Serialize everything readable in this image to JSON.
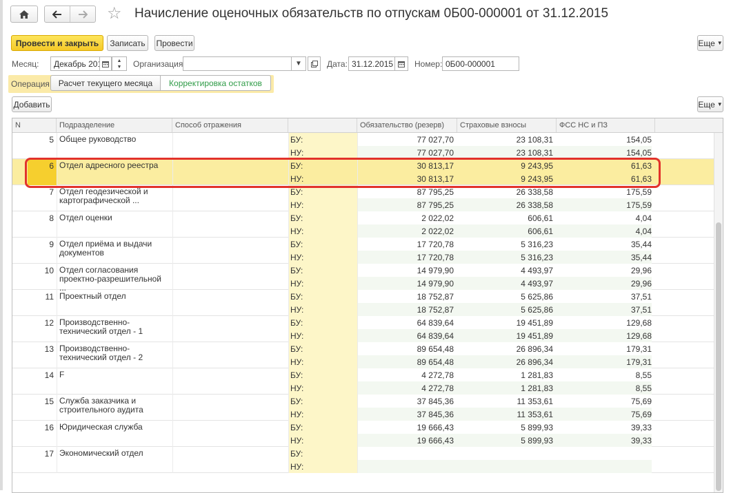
{
  "title": "Начисление оценочных обязательств по отпускам 0Б00-000001 от 31.12.2015",
  "toolbar": {
    "post_close": "Провести и закрыть",
    "save": "Записать",
    "post": "Провести",
    "more": "Еще"
  },
  "form": {
    "month_label": "Месяц:",
    "month_value": "Декабрь 201",
    "org_label": "Организация:",
    "org_value": "",
    "date_label": "Дата:",
    "date_value": "31.12.2015",
    "number_label": "Номер:",
    "number_value": "0Б00-000001"
  },
  "operation": {
    "label": "Операция:",
    "options": [
      "Расчет текущего месяца",
      "Корректировка остатков"
    ],
    "selected": "Расчет текущего месяца"
  },
  "table_toolbar": {
    "add": "Добавить",
    "more": "Еще"
  },
  "table": {
    "headers": [
      "N",
      "Подразделение",
      "Способ отражения",
      "",
      "Обязательство (резерв)",
      "Страховые взносы",
      "ФСС НС и ПЗ"
    ],
    "rows": [
      {
        "n": "5",
        "name": "Общее руководство",
        "bu_label": "БУ:",
        "nu_label": "НУ:",
        "bu": [
          "77 027,70",
          "23 108,31",
          "154,05"
        ],
        "nu": [
          "77 027,70",
          "23 108,31",
          "154,05"
        ]
      },
      {
        "n": "6",
        "name": "Отдел адресного реестра",
        "bu_label": "БУ:",
        "nu_label": "НУ:",
        "bu": [
          "30 813,17",
          "9 243,95",
          "61,63"
        ],
        "nu": [
          "30 813,17",
          "9 243,95",
          "61,63"
        ]
      },
      {
        "n": "7",
        "name": "Отдел геодезической и картографической ...",
        "bu_label": "БУ:",
        "nu_label": "НУ:",
        "bu": [
          "87 795,25",
          "26 338,58",
          "175,59"
        ],
        "nu": [
          "87 795,25",
          "26 338,58",
          "175,59"
        ]
      },
      {
        "n": "8",
        "name": "Отдел оценки",
        "bu_label": "БУ:",
        "nu_label": "НУ:",
        "bu": [
          "2 022,02",
          "606,61",
          "4,04"
        ],
        "nu": [
          "2 022,02",
          "606,61",
          "4,04"
        ]
      },
      {
        "n": "9",
        "name": "Отдел приёма и выдачи документов",
        "bu_label": "БУ:",
        "nu_label": "НУ:",
        "bu": [
          "17 720,78",
          "5 316,23",
          "35,44"
        ],
        "nu": [
          "17 720,78",
          "5 316,23",
          "35,44"
        ]
      },
      {
        "n": "10",
        "name": "Отдел согласования проектно-разрешительной ...",
        "bu_label": "БУ:",
        "nu_label": "НУ:",
        "bu": [
          "14 979,90",
          "4 493,97",
          "29,96"
        ],
        "nu": [
          "14 979,90",
          "4 493,97",
          "29,96"
        ]
      },
      {
        "n": "11",
        "name": "Проектный отдел",
        "bu_label": "БУ:",
        "nu_label": "НУ:",
        "bu": [
          "18 752,87",
          "5 625,86",
          "37,51"
        ],
        "nu": [
          "18 752,87",
          "5 625,86",
          "37,51"
        ]
      },
      {
        "n": "12",
        "name": "Производственно-технический отдел - 1",
        "bu_label": "БУ:",
        "nu_label": "НУ:",
        "bu": [
          "64 839,64",
          "19 451,89",
          "129,68"
        ],
        "nu": [
          "64 839,64",
          "19 451,89",
          "129,68"
        ]
      },
      {
        "n": "13",
        "name": "Производственно-технический отдел - 2",
        "bu_label": "БУ:",
        "nu_label": "НУ:",
        "bu": [
          "89 654,48",
          "26 896,34",
          "179,31"
        ],
        "nu": [
          "89 654,48",
          "26 896,34",
          "179,31"
        ]
      },
      {
        "n": "14",
        "name": "F",
        "bu_label": "БУ:",
        "nu_label": "НУ:",
        "bu": [
          "4 272,78",
          "1 281,83",
          "8,55"
        ],
        "nu": [
          "4 272,78",
          "1 281,83",
          "8,55"
        ]
      },
      {
        "n": "15",
        "name": "Служба заказчика и строительного аудита",
        "bu_label": "БУ:",
        "nu_label": "НУ:",
        "bu": [
          "37 845,36",
          "11 353,61",
          "75,69"
        ],
        "nu": [
          "37 845,36",
          "11 353,61",
          "75,69"
        ]
      },
      {
        "n": "16",
        "name": "Юридическая служба",
        "bu_label": "БУ:",
        "nu_label": "НУ:",
        "bu": [
          "19 666,43",
          "5 899,93",
          "39,33"
        ],
        "nu": [
          "19 666,43",
          "5 899,93",
          "39,33"
        ]
      },
      {
        "n": "17",
        "name": "Экономический отдел",
        "bu_label": "БУ:",
        "nu_label": "НУ:",
        "bu": [
          "",
          "",
          ""
        ],
        "nu": [
          "",
          "",
          ""
        ]
      }
    ],
    "selected_row": "6"
  },
  "icons": {
    "home": "home-icon",
    "back": "arrow-left-icon",
    "forward": "arrow-right-icon",
    "favorite": "star-icon",
    "calendar": "calendar-icon",
    "open": "open-form-icon"
  },
  "colors": {
    "primary_button": "#f5c928",
    "selected_row": "#fbeda0",
    "highlight_box": "#e2322b",
    "inactive_option_text": "#2e9b46"
  }
}
